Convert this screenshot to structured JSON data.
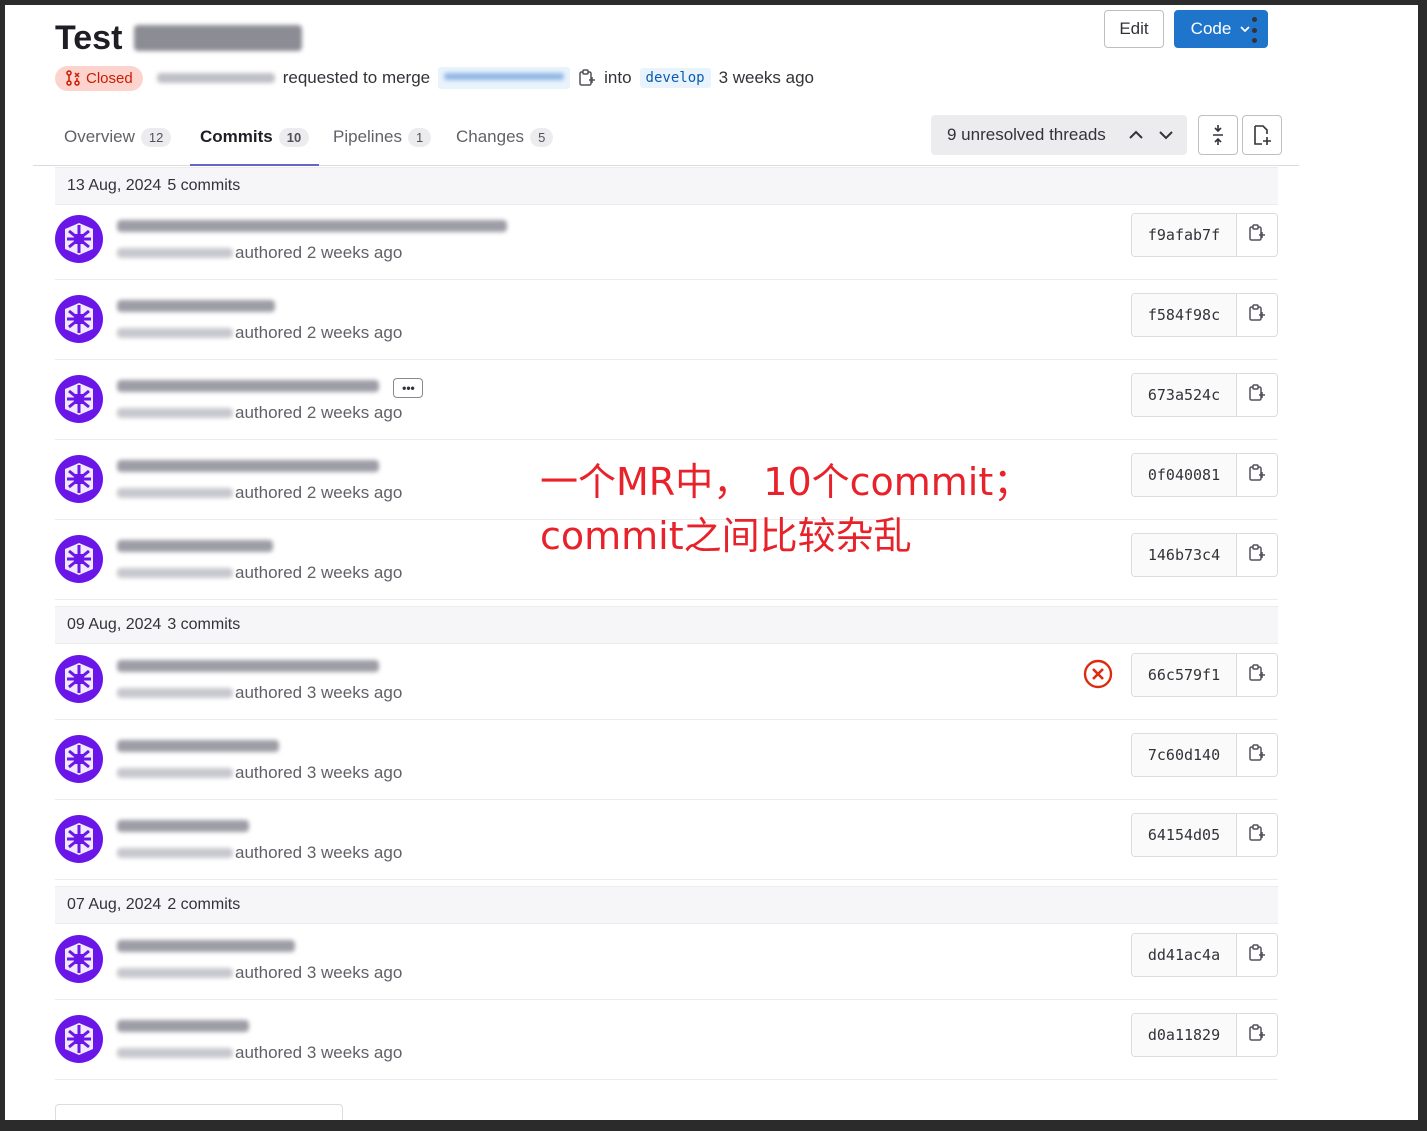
{
  "header": {
    "title": "Test",
    "edit_label": "Edit",
    "code_label": "Code",
    "more_icon": "kebab-icon"
  },
  "meta": {
    "status": "Closed",
    "requested_text": "requested to merge",
    "into_text": "into",
    "target_branch": "develop",
    "time_ago": "3 weeks ago",
    "status_color": "#c91c00"
  },
  "tabs": [
    {
      "label": "Overview",
      "count": "12"
    },
    {
      "label": "Commits",
      "count": "10"
    },
    {
      "label": "Pipelines",
      "count": "1"
    },
    {
      "label": "Changes",
      "count": "5"
    }
  ],
  "threads": {
    "label": "9 unresolved threads"
  },
  "days": [
    {
      "date": "13 Aug, 2024",
      "count": "5 commits"
    },
    {
      "date": "09 Aug, 2024",
      "count": "3 commits"
    },
    {
      "date": "07 Aug, 2024",
      "count": "2 commits"
    }
  ],
  "commits": [
    {
      "authored": "authored 2 weeks ago",
      "sha": "f9afab7f"
    },
    {
      "authored": "authored 2 weeks ago",
      "sha": "f584f98c"
    },
    {
      "authored": "authored 2 weeks ago",
      "sha": "673a524c"
    },
    {
      "authored": "authored 2 weeks ago",
      "sha": "0f040081"
    },
    {
      "authored": "authored 2 weeks ago",
      "sha": "146b73c4"
    },
    {
      "authored": "authored 3 weeks ago",
      "sha": "66c579f1"
    },
    {
      "authored": "authored 3 weeks ago",
      "sha": "7c60d140"
    },
    {
      "authored": "authored 3 weeks ago",
      "sha": "64154d05"
    },
    {
      "authored": "authored 3 weeks ago",
      "sha": "dd41ac4a"
    },
    {
      "authored": "authored 3 weeks ago",
      "sha": "d0a11829"
    }
  ],
  "annotation": {
    "line1": "一个MR中， 10个commit；",
    "line2": "commit之间比较杂乱",
    "color": "#e8222a"
  },
  "colors": {
    "accent": "#1f75cb",
    "avatar": "#6b16e8",
    "tab_active": "#6666c4"
  }
}
